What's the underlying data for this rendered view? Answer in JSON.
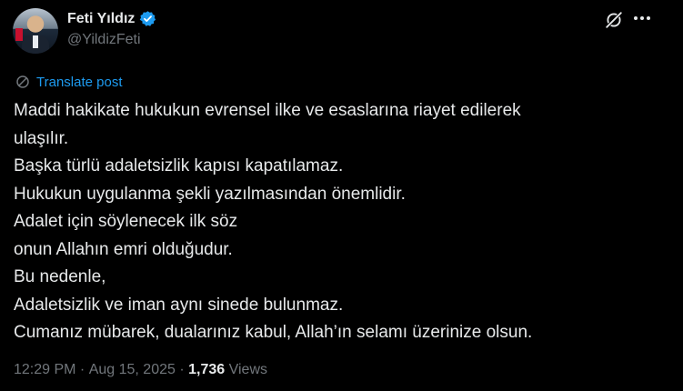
{
  "author": {
    "name": "Feti Yıldız",
    "handle": "@YildizFeti"
  },
  "translate_label": "Translate post",
  "post_lines": [
    "Maddi hakikate hukukun evrensel ilke ve esaslarına riayet edilerek",
    "ulaşılır.",
    "Başka türlü adaletsizlik kapısı kapatılamaz.",
    "Hukukun uygulanma şekli yazılmasından önemlidir.",
    "Adalet için söylenecek ilk söz",
    "onun Allahın emri olduğudur.",
    "Bu nedenle,",
    "Adaletsizlik ve iman aynı sinede bulunmaz.",
    "Cumanız mübarek, dualarınız kabul, Allah’ın selamı üzerinize olsun."
  ],
  "meta": {
    "time": "12:29 PM",
    "separator": " · ",
    "date": "Aug 15, 2025",
    "views_count": "1,736",
    "views_label": " Views"
  },
  "colors": {
    "background": "#000000",
    "text": "#e7e9ea",
    "muted": "#71767b",
    "accent": "#1d9bf0"
  },
  "icons": [
    "verified-badge-icon",
    "grok-icon",
    "more-options-icon",
    "translate-icon"
  ]
}
